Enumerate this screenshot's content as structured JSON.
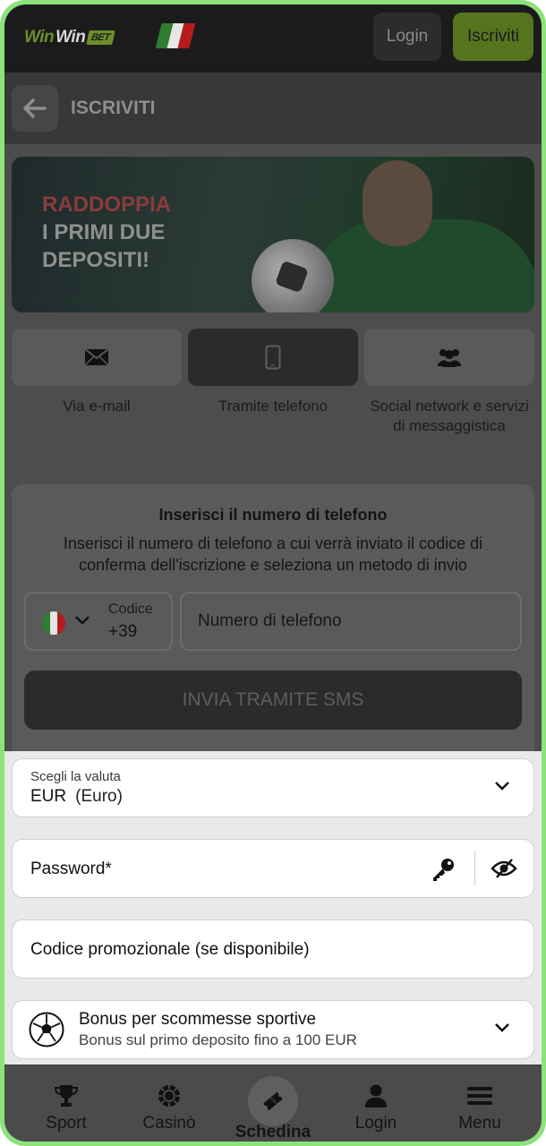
{
  "header": {
    "logo": {
      "word1": "Win",
      "word2": "Win",
      "badge": "BET"
    },
    "flag_colors": [
      "#2e7d32",
      "#e6e6e6",
      "#b71c1c"
    ],
    "login_label": "Login",
    "signup_label": "Iscriviti"
  },
  "subheader": {
    "title": "ISCRIVITI",
    "back_icon": "arrow-left-icon"
  },
  "banner": {
    "line1": "RADDOPPIA",
    "line2": "I PRIMI DUE",
    "line3": "DEPOSITI!"
  },
  "methods": [
    {
      "label": "Via e-mail",
      "icon": "envelope-icon",
      "active": false
    },
    {
      "label": "Tramite telefono",
      "icon": "phone-icon",
      "active": true
    },
    {
      "label": "Social network e servizi di messaggistica",
      "icon": "users-icon",
      "active": false
    }
  ],
  "phone_form": {
    "title": "Inserisci il numero di telefono",
    "description": "Inserisci il numero di telefono a cui verrà inviato il codice di conferma dell'iscrizione e seleziona un metodo di invio",
    "code_caption": "Codice",
    "code_value": "+39",
    "phone_placeholder": "Numero di telefono",
    "sms_button": "INVIA TRAMITE SMS"
  },
  "currency": {
    "caption": "Scegli la valuta",
    "code": "EUR",
    "name": "(Euro)"
  },
  "password": {
    "label": "Password*"
  },
  "promo": {
    "label": "Codice promozionale (se disponibile)"
  },
  "bonus": {
    "title": "Bonus per scommesse sportive",
    "subtitle": "Bonus sul primo deposito fino a 100 EUR"
  },
  "bottom_nav": [
    {
      "label": "Sport",
      "icon": "trophy-icon"
    },
    {
      "label": "Casinò",
      "icon": "casino-chip-icon"
    },
    {
      "label": "Schedina",
      "icon": "ticket-icon"
    },
    {
      "label": "Login",
      "icon": "user-icon"
    },
    {
      "label": "Menu",
      "icon": "hamburger-icon"
    }
  ],
  "colors": {
    "accent_green": "#6c8f2a",
    "frame_green": "#8ce37a"
  }
}
